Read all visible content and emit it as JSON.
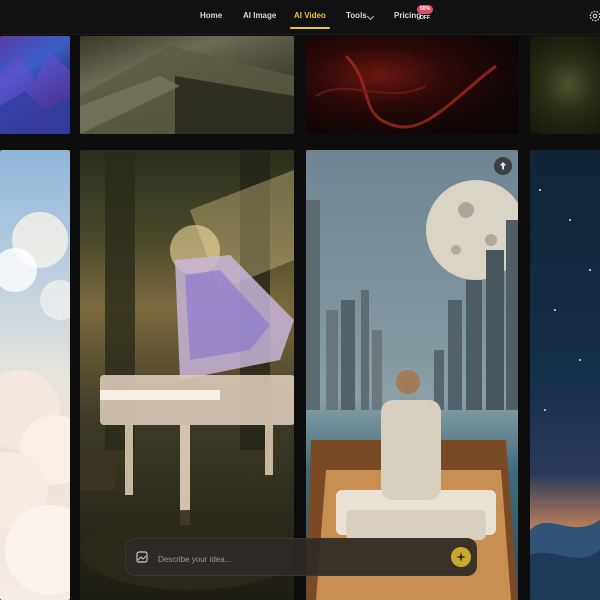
{
  "nav": {
    "items": [
      {
        "label": "Home"
      },
      {
        "label": "AI Image"
      },
      {
        "label": "AI Video"
      },
      {
        "label": "Tools"
      },
      {
        "label": "Pricing"
      }
    ],
    "active_item": "AI Video",
    "pricing_badge": "50% OFF",
    "accent_color": "#e9c33b",
    "badge_color": "#e24b6c"
  },
  "icons": {
    "settings": "gear-icon",
    "tools_menu": "chevron-down-icon",
    "pin": "pin-icon",
    "prompt": "image-icon",
    "submit": "sparkle-icon"
  },
  "gallery": {
    "tiles": [
      {
        "subject": "purple crystal landscape"
      },
      {
        "subject": "stone rooftop"
      },
      {
        "subject": "red lava"
      },
      {
        "subject": "forest lights"
      },
      {
        "subject": "clouds"
      },
      {
        "subject": "crystal grand piano in forest"
      },
      {
        "subject": "city skyline with moon and boat"
      },
      {
        "subject": "night sky over waves"
      }
    ]
  },
  "prompt": {
    "placeholder": "Describe your idea..."
  }
}
